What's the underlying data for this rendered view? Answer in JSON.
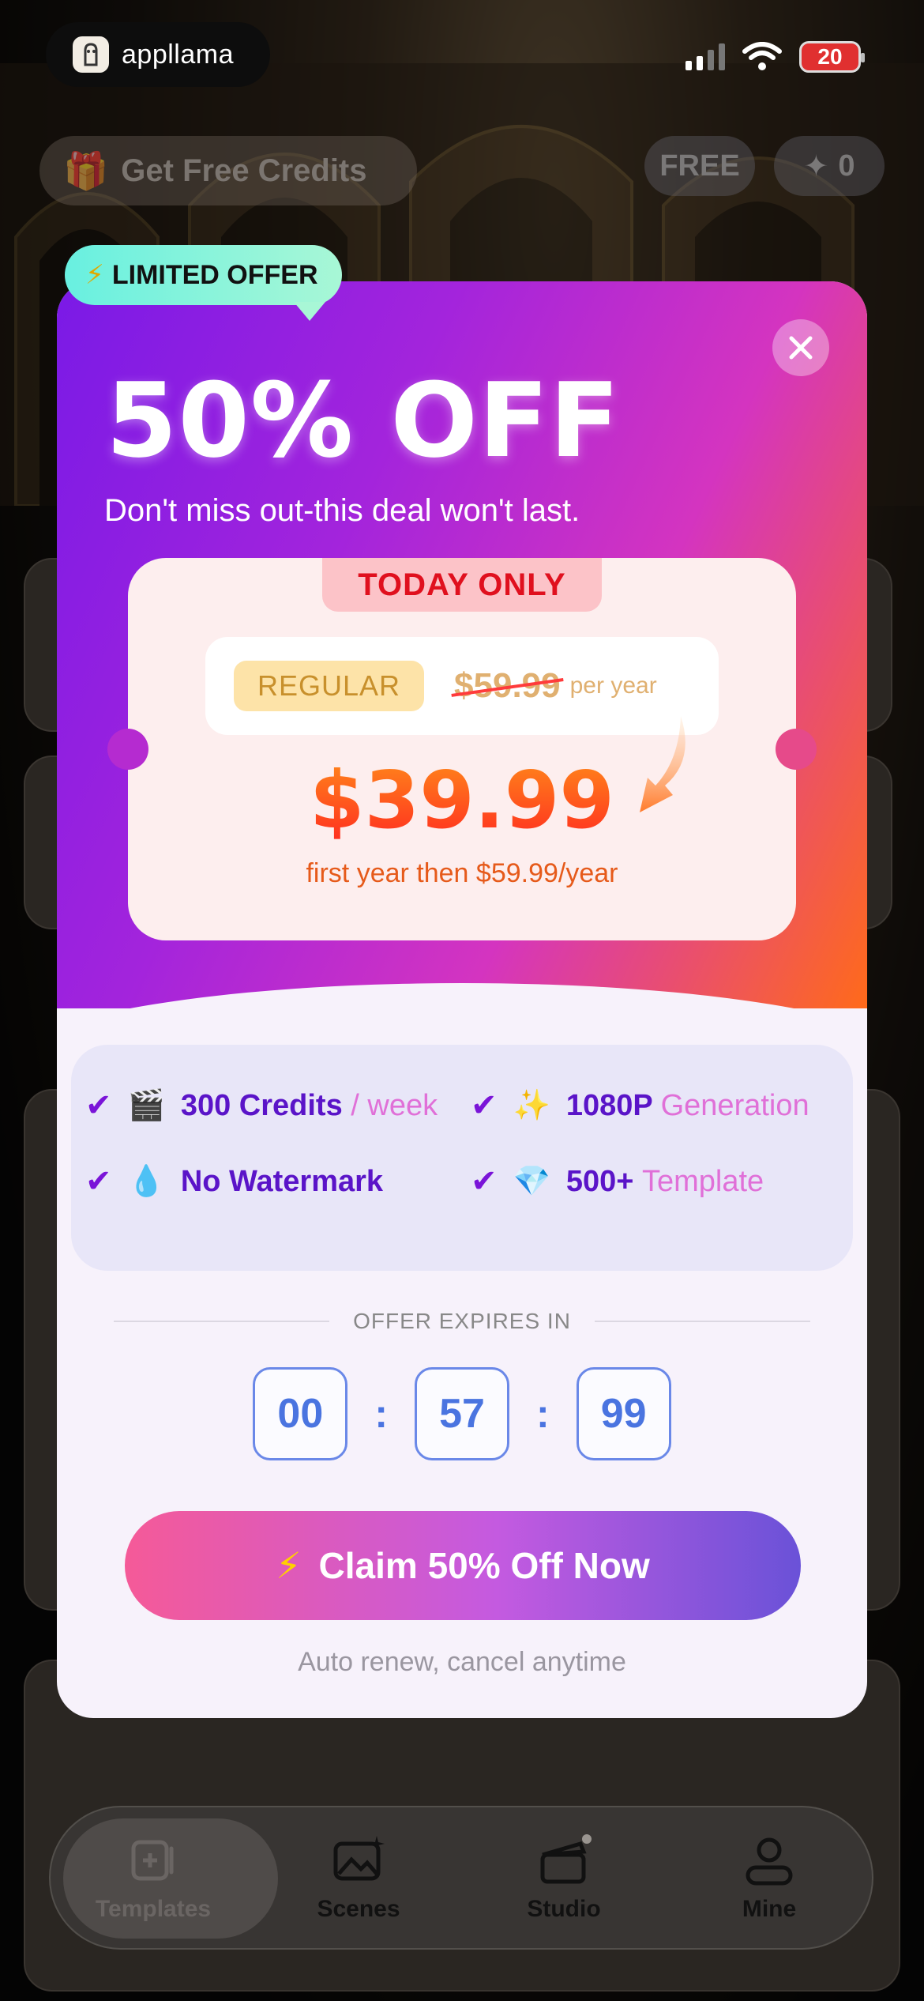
{
  "status": {
    "brand": "appllama",
    "battery": "20"
  },
  "header": {
    "get_credits": "Get Free Credits",
    "free_badge": "FREE",
    "credit_count": "0"
  },
  "tabs": [
    {
      "label": "Templates",
      "icon": "templates-icon",
      "active": true
    },
    {
      "label": "Scenes",
      "icon": "scenes-icon",
      "active": false
    },
    {
      "label": "Studio",
      "icon": "clapperboard-icon",
      "active": false
    },
    {
      "label": "Mine",
      "icon": "person-icon",
      "active": false
    }
  ],
  "offer": {
    "tag": "LIMITED OFFER",
    "headline": "50% OFF",
    "subhead": "Don't miss out-this deal won't last.",
    "today_only": "TODAY ONLY",
    "regular_label": "REGULAR",
    "regular_price": "$59.99",
    "per_year": "per year",
    "new_price": "$39.99",
    "then_text": "first year then $59.99/year",
    "features": [
      {
        "emoji": "🎬",
        "text": "300 Credits",
        "accent": "/ week"
      },
      {
        "emoji": "✨",
        "text": "1080P",
        "accent": "Generation"
      },
      {
        "emoji": "💧",
        "text": "No Watermark",
        "accent": ""
      },
      {
        "emoji": "💎",
        "text": "500+",
        "accent": "Template"
      }
    ],
    "expires_label": "OFFER EXPIRES IN",
    "timer": {
      "hours": "00",
      "minutes": "57",
      "seconds": "99"
    },
    "claim_label": "Claim 50% Off Now",
    "auto_renew": "Auto renew, cancel anytime"
  },
  "colors": {
    "accent_purple": "#7a1ae6",
    "accent_orange": "#ff6a1a",
    "price_red": "#ff4a1a",
    "timer_blue": "#4a74e0"
  }
}
